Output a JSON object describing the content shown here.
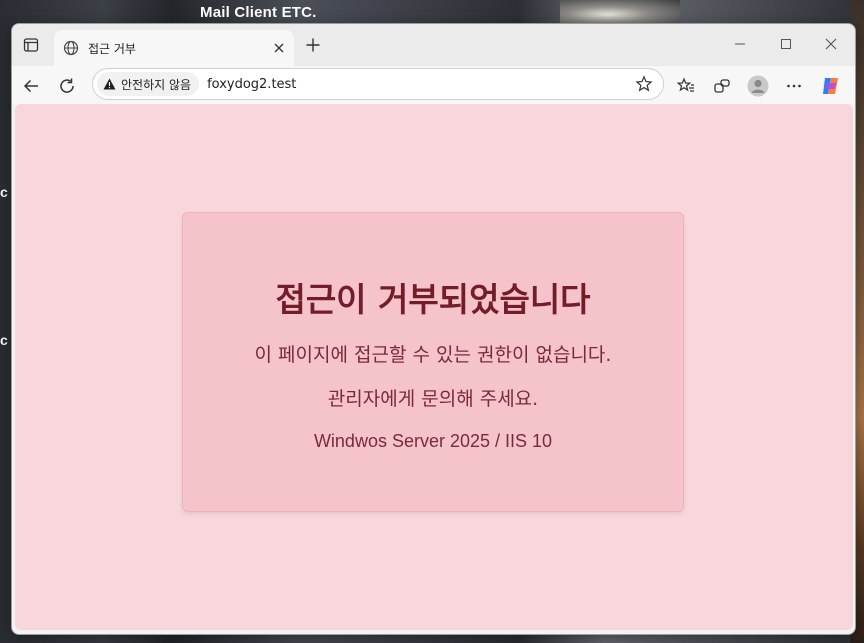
{
  "desktop": {
    "window_title": "Mail Client ETC.",
    "left_glyph_1": "c",
    "left_glyph_2": "c"
  },
  "browser": {
    "tab": {
      "title": "접근 거부",
      "icon": "globe-icon"
    },
    "address": {
      "security_label": "안전하지 않음",
      "url": "foxydog2.test"
    },
    "toolbar_icons": [
      "back-icon",
      "refresh-icon",
      "favorites-icon",
      "collections-icon",
      "profile-icon",
      "more-icon",
      "copilot-icon"
    ]
  },
  "page": {
    "heading": "접근이 거부되었습니다",
    "message": "이 페이지에 접근할 수 있는 권한이 없습니다.",
    "contact": "관리자에게 문의해 주세요.",
    "server": "Windwos Server 2025 / IIS 10"
  },
  "colors": {
    "page_background": "#f7d7db",
    "card_background": "#f5c4cb",
    "heading": "#741c28"
  }
}
